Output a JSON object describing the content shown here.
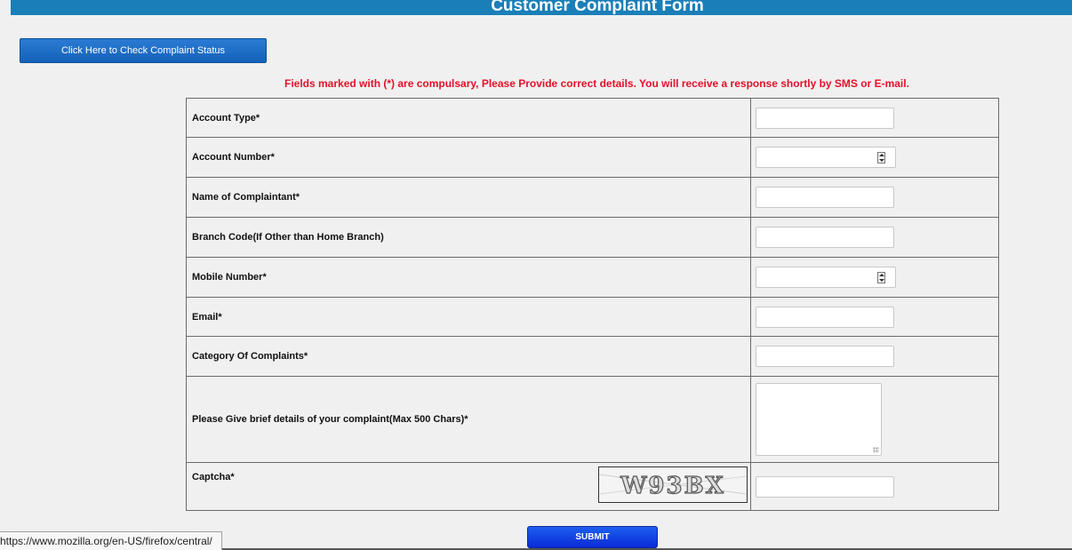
{
  "header": {
    "title": "Customer Complaint Form"
  },
  "status_button": {
    "label": "Click Here to Check Complaint Status"
  },
  "notice": {
    "text": "Fields marked with (*) are compulsary, Please Provide correct details. You will receive a response shortly by SMS or E-mail."
  },
  "form": {
    "fields": [
      {
        "label": "Account Type*",
        "value": ""
      },
      {
        "label": "Account Number*",
        "value": ""
      },
      {
        "label": "Name of Complaintant*",
        "value": ""
      },
      {
        "label": "Branch Code(If Other than Home Branch)",
        "value": ""
      },
      {
        "label": "Mobile Number*",
        "value": ""
      },
      {
        "label": "Email*",
        "value": ""
      },
      {
        "label": "Category Of Complaints*",
        "value": ""
      },
      {
        "label": "Please Give brief details of your complaint(Max 500 Chars)*",
        "value": ""
      },
      {
        "label": "Captcha*",
        "value": ""
      }
    ],
    "captcha_text": "W93BX"
  },
  "submit_button": {
    "label": "SUBMIT"
  },
  "status_bar": {
    "url": "https://www.mozilla.org/en-US/firefox/central/"
  },
  "colors": {
    "header": "#1a7fb8",
    "notice": "#e4102a",
    "submit": "#1d5ff0",
    "status_button": "#1462b8"
  },
  "icons": [
    "spinner-icon",
    "resize-grip-icon"
  ]
}
